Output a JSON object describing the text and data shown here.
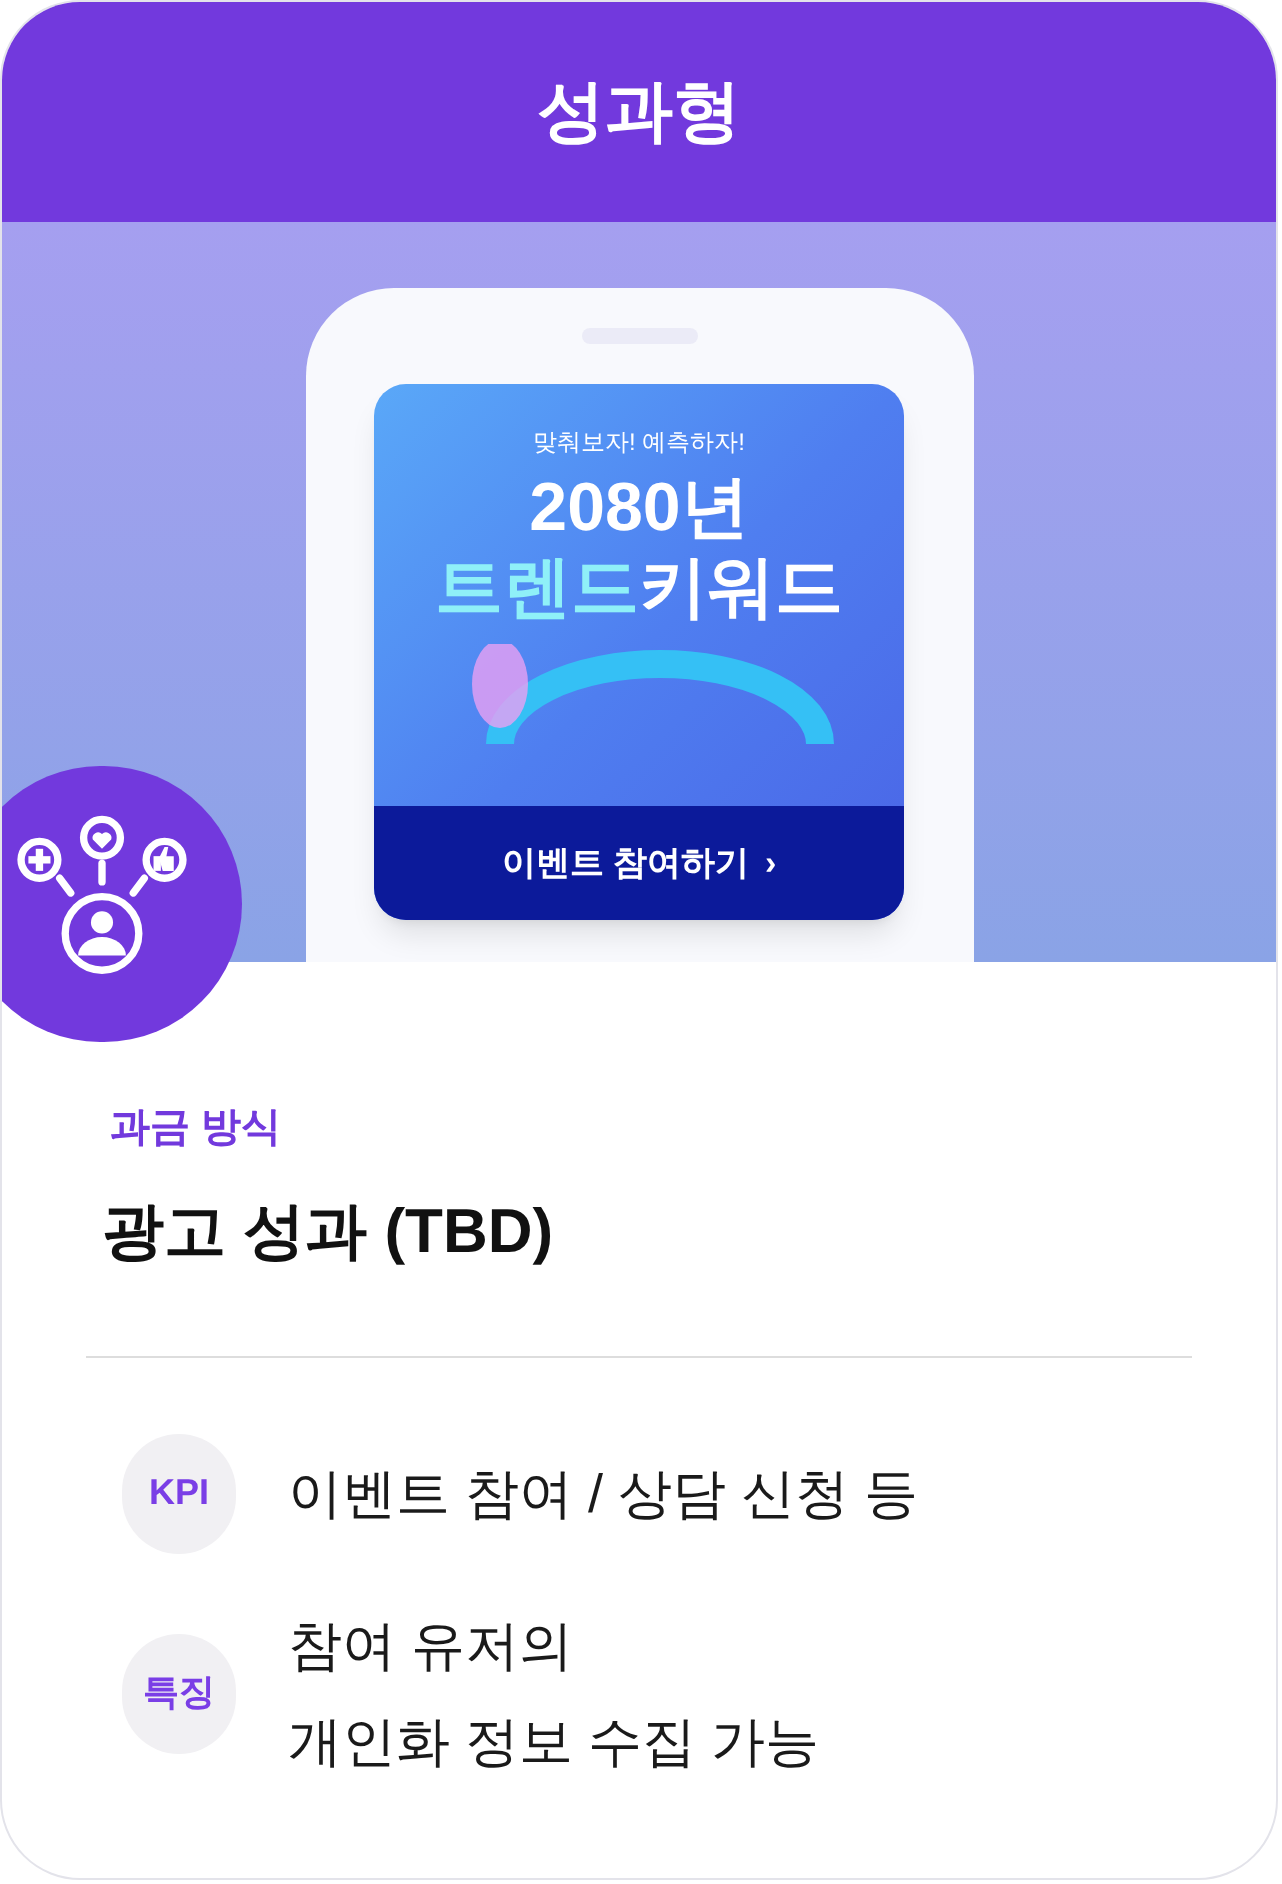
{
  "header": {
    "title": "성과형"
  },
  "banner": {
    "subtitle": "맞춰보자! 예측하자!",
    "title_line1": "2080년",
    "title_line2_highlight": "트렌드",
    "title_line2_rest": "키워드",
    "button": {
      "label": "이벤트 참여하기",
      "arrow": "›"
    }
  },
  "billing": {
    "label": "과금 방식",
    "value": "광고 성과 (TBD)"
  },
  "features": [
    {
      "tag": "KPI",
      "lines": [
        "이벤트 참여 / 상담 신청 등"
      ]
    },
    {
      "tag": "특징",
      "lines": [
        "참여 유저의",
        "개인화 정보 수집 가능"
      ]
    }
  ]
}
